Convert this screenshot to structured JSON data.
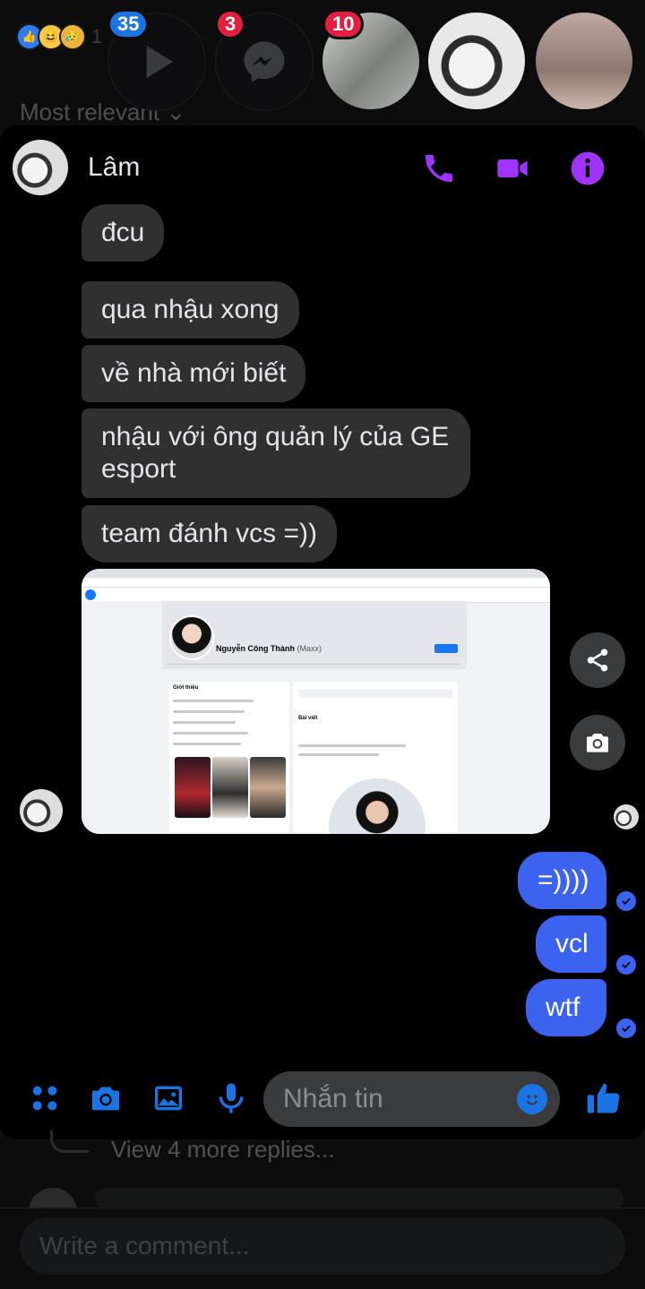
{
  "background": {
    "reaction_count": "1",
    "sort_label": "Most relevant",
    "more_replies": "View 4 more replies...",
    "comment_placeholder": "Write a comment..."
  },
  "chat_heads": [
    {
      "name": "video",
      "badge": "35",
      "badge_color": "#1b74e4"
    },
    {
      "name": "messenger",
      "badge": "3",
      "badge_color": "#e41e3f"
    },
    {
      "name": "group-photo",
      "badge": "10",
      "badge_color": "#e41e3f"
    },
    {
      "name": "lam"
    },
    {
      "name": "girl"
    }
  ],
  "chat": {
    "contact_name": "Lâm",
    "accent_color": "#a033ff",
    "received": [
      "đcu",
      "qua nhậu xong",
      "về nhà mới biết",
      "nhậu với ông quản lý của GE esport",
      "team đánh vcs =))"
    ],
    "sent": [
      "=))))",
      "vcl",
      "wtf"
    ],
    "sent_color": "#3c63f0",
    "attachment": {
      "profile_name": "Nguyễn Công Thành",
      "profile_alias": "(Maxx)",
      "intro_label": "Giới thiệu",
      "posts_label": "Bài viết"
    },
    "input_placeholder": "Nhắn tin"
  }
}
